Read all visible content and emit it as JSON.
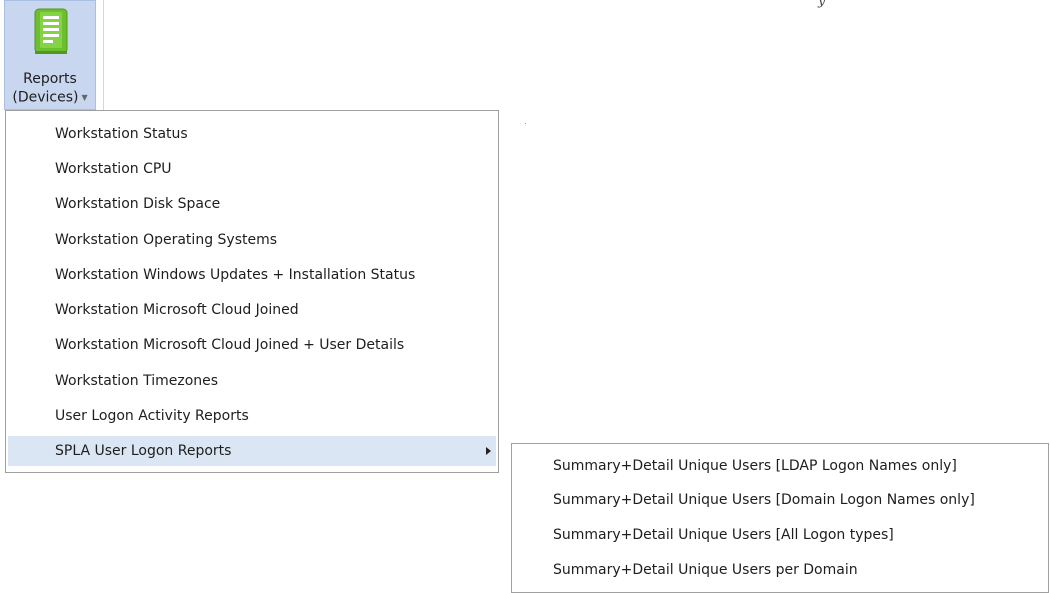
{
  "ribbon": {
    "reports_button": {
      "line1": "Reports",
      "line2": "(Devices)",
      "icon": "report-document-icon",
      "icon_color": "#6cbf2e"
    },
    "top_fragment": "y"
  },
  "main_menu": {
    "items": [
      {
        "label": "Workstation Status"
      },
      {
        "label": "Workstation CPU"
      },
      {
        "label": "Workstation Disk Space"
      },
      {
        "label": "Workstation Operating Systems"
      },
      {
        "label": "Workstation Windows Updates + Installation Status"
      },
      {
        "label": "Workstation Microsoft Cloud Joined"
      },
      {
        "label": "Workstation Microsoft Cloud Joined + User Details"
      },
      {
        "label": "Workstation Timezones"
      },
      {
        "label": "User Logon Activity Reports"
      },
      {
        "label": "SPLA User Logon Reports",
        "has_submenu": true,
        "highlighted": true
      }
    ]
  },
  "sub_menu": {
    "items": [
      {
        "label": "Summary+Detail Unique Users [LDAP Logon Names only]"
      },
      {
        "label": "Summary+Detail Unique Users [Domain Logon Names only]"
      },
      {
        "label": "Summary+Detail Unique Users [All Logon types]"
      },
      {
        "label": "Summary+Detail Unique Users per Domain"
      }
    ]
  },
  "colors": {
    "ribbon_button_pressed": "#c8d7ef",
    "menu_highlight": "#dbe6f4",
    "menu_border": "#a0a0a0"
  }
}
